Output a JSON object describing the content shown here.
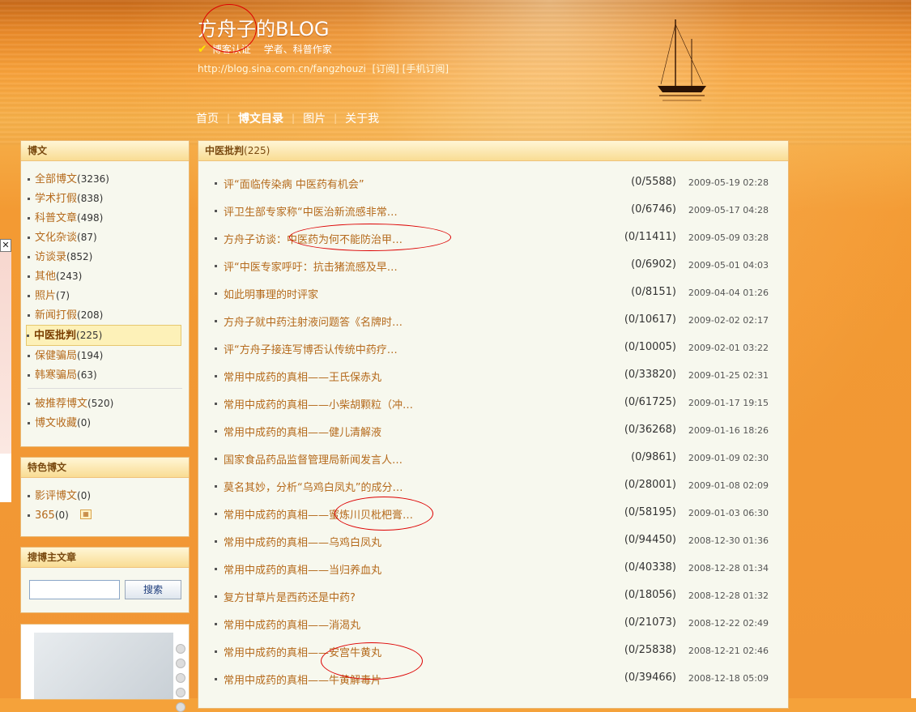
{
  "header": {
    "blog_title": "方舟子的BLOG",
    "verify_label": "博客认证",
    "verify_desc": "学者、科普作家",
    "url": "http://blog.sina.com.cn/fangzhouzi",
    "subscribe": "[订阅]",
    "mobile_subscribe": "[手机订阅]"
  },
  "nav": {
    "items": [
      {
        "label": "首页"
      },
      {
        "label": "博文目录"
      },
      {
        "label": "图片"
      },
      {
        "label": "关于我"
      }
    ]
  },
  "sidebar": {
    "blog_panel_title": "博文",
    "categories": [
      {
        "label": "全部博文",
        "count": "(3236)"
      },
      {
        "label": "学术打假",
        "count": "(838)"
      },
      {
        "label": "科普文章",
        "count": "(498)"
      },
      {
        "label": "文化杂谈",
        "count": "(87)"
      },
      {
        "label": "访谈录",
        "count": "(852)"
      },
      {
        "label": "其他",
        "count": "(243)"
      },
      {
        "label": "照片",
        "count": "(7)"
      },
      {
        "label": "新闻打假",
        "count": "(208)"
      },
      {
        "label": "中医批判",
        "count": "(225)"
      },
      {
        "label": "保健骗局",
        "count": "(194)"
      },
      {
        "label": "韩寒骗局",
        "count": "(63)"
      }
    ],
    "extra": [
      {
        "label": "被推荐博文",
        "count": "(520)"
      },
      {
        "label": "博文收藏",
        "count": "(0)"
      }
    ],
    "featured_title": "特色博文",
    "featured": [
      {
        "label": "影评博文",
        "count": "(0)"
      },
      {
        "label": "365",
        "count": "(0)"
      }
    ],
    "search_title": "搜博主文章",
    "search_button": "搜索"
  },
  "main": {
    "title": "中医批判",
    "count": "(225)",
    "articles": [
      {
        "title": "评“面临传染病 中医药有机会”",
        "stats": "(0/5588)",
        "date": "2009-05-19 02:28"
      },
      {
        "title": "评卫生部专家称“中医治新流感非常…",
        "stats": "(0/6746)",
        "date": "2009-05-17 04:28"
      },
      {
        "title": "方舟子访谈：中医药为何不能防治甲…",
        "stats": "(0/11411)",
        "date": "2009-05-09 03:28"
      },
      {
        "title": "评“中医专家呼吁：抗击猪流感及早…",
        "stats": "(0/6902)",
        "date": "2009-05-01 04:03"
      },
      {
        "title": "如此明事理的时评家",
        "stats": "(0/8151)",
        "date": "2009-04-04 01:26"
      },
      {
        "title": "方舟子就中药注射液问题答《名牌时…",
        "stats": "(0/10617)",
        "date": "2009-02-02 02:17"
      },
      {
        "title": "评“方舟子接连写博否认传统中药疗…",
        "stats": "(0/10005)",
        "date": "2009-02-01 03:22"
      },
      {
        "title": "常用中成药的真相——王氏保赤丸",
        "stats": "(0/33820)",
        "date": "2009-01-25 02:31"
      },
      {
        "title": "常用中成药的真相——小柴胡颗粒（冲…",
        "stats": "(0/61725)",
        "date": "2009-01-17 19:15"
      },
      {
        "title": "常用中成药的真相——健儿清解液",
        "stats": "(0/36268)",
        "date": "2009-01-16 18:26"
      },
      {
        "title": "国家食品药品监督管理局新闻发言人…",
        "stats": "(0/9861)",
        "date": "2009-01-09 02:30"
      },
      {
        "title": "莫名其妙，分析“乌鸡白凤丸”的成分…",
        "stats": "(0/28001)",
        "date": "2009-01-08 02:09"
      },
      {
        "title": "常用中成药的真相——蜜炼川贝枇杷膏…",
        "stats": "(0/58195)",
        "date": "2009-01-03 06:30"
      },
      {
        "title": "常用中成药的真相——乌鸡白凤丸",
        "stats": "(0/94450)",
        "date": "2008-12-30 01:36"
      },
      {
        "title": "常用中成药的真相——当归养血丸",
        "stats": "(0/40338)",
        "date": "2008-12-28 01:34"
      },
      {
        "title": "复方甘草片是西药还是中药?",
        "stats": "(0/18056)",
        "date": "2008-12-28 01:32"
      },
      {
        "title": "常用中成药的真相——消渴丸",
        "stats": "(0/21073)",
        "date": "2008-12-22 02:49"
      },
      {
        "title": "常用中成药的真相——安宫牛黄丸",
        "stats": "(0/25838)",
        "date": "2008-12-21 02:46"
      },
      {
        "title": "常用中成药的真相——牛黄解毒片",
        "stats": "(0/39466)",
        "date": "2008-12-18 05:09"
      }
    ]
  },
  "ad": {
    "close_label": "✕"
  },
  "colors": {
    "link": "#b56a1c",
    "panel_border": "#e9b873",
    "annotation": "#dd0000"
  }
}
